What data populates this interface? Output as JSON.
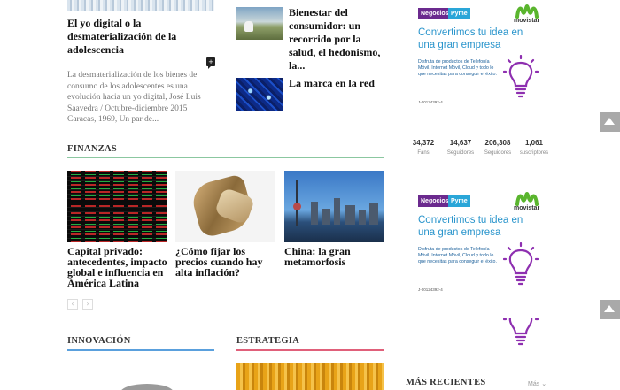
{
  "top_article": {
    "title": "El yo digital o la desmaterialización de la adolescencia",
    "excerpt": "La desmaterialización de los bienes de consumo de los adolescentes es una evolución hacia un yo digital, José Luis Saavedra / Octubre-diciembre 2015 Caracas, 1969, Un par de..."
  },
  "side_articles": [
    {
      "title": "Bienestar del consumidor: un recorrido por la salud, el hedonismo, la..."
    },
    {
      "title": "La marca en la red"
    }
  ],
  "finanzas": {
    "heading": "FINANZAS",
    "articles": [
      {
        "title": "Capital privado: antecedentes, impacto global e influencia en América Latina"
      },
      {
        "title": "¿Cómo fijar los precios cuando hay alta inflación?"
      },
      {
        "title": "China: la gran metamorfosis"
      }
    ],
    "prev_label": "‹",
    "next_label": "›"
  },
  "innovacion": {
    "heading": "INNOVACIÓN"
  },
  "estrategia": {
    "heading": "ESTRATEGIA"
  },
  "ad": {
    "tag_negocios": "Negocios",
    "tag_pyme": "Pyme",
    "brand": "movistar",
    "headline": "Convertimos tu idea en una gran empresa",
    "body": "Disfruta de productos de Telefonía Móvil, Internet Móvil, Cloud y todo lo que necesitas para conseguir el éxito.",
    "footer": "J-00124392-4",
    "colors": {
      "purple": "#6b2a8e",
      "blue": "#2aa6d8",
      "green": "#5ab52e"
    }
  },
  "social_stats": [
    {
      "value": "34,372",
      "label": "Fans"
    },
    {
      "value": "14,637",
      "label": "Seguidores"
    },
    {
      "value": "206,308",
      "label": "Seguidores"
    },
    {
      "value": "1,061",
      "label": "suscriptores"
    }
  ],
  "recientes": {
    "heading": "MÁS RECIENTES",
    "more_label": "Más"
  }
}
